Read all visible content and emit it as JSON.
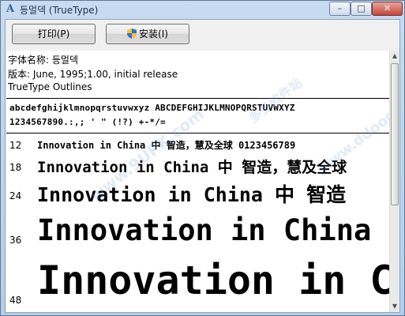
{
  "window": {
    "title": "등멀덱 (TrueType)",
    "controls": {
      "minimize": "–",
      "maximize": "□",
      "close": "✕"
    }
  },
  "toolbar": {
    "print_label": "打印(P)",
    "install_label": "安装(I)"
  },
  "font_info": {
    "name_line": "字体名称: 등멀덱",
    "version_line": "版本: June, 1995;1.00, initial release",
    "type_line": "TrueType Outlines"
  },
  "charset": {
    "line1": "abcdefghijklmnopqrstuvwxyz ABCDEFGHIJKLMNOPQRSTUVWXYZ",
    "line2": "1234567890.:,; ' \" (!?) +-*/="
  },
  "samples": [
    {
      "size": "12",
      "text": "Innovation in China 中  智造，慧及全球 0123456789"
    },
    {
      "size": "18",
      "text": "Innovation in China 中  智造，慧及全球"
    },
    {
      "size": "24",
      "text": "Innovation in China 中  智造"
    },
    {
      "size": "36",
      "text": "Innovation in China"
    },
    {
      "size": "48",
      "text": "Innovation in C"
    }
  ],
  "watermarks": {
    "site1": "www.9UPK.com",
    "site2": "多多软件站",
    "site3": "www.ddooo.com"
  },
  "scrollbar": {
    "up_arrow": "▲",
    "down_arrow": "▼"
  },
  "colors": {
    "title_bar": "#c7dbf1",
    "close_button": "#c3463a",
    "content_bg": "#ffffff"
  }
}
